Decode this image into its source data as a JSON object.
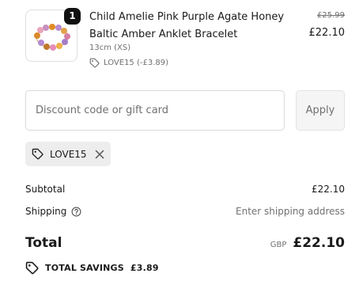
{
  "line_item": {
    "quantity": "1",
    "title": "Child Amelie Pink Purple Agate Honey Baltic Amber Anklet Bracelet",
    "variant": "13cm (XS)",
    "discount": "LOVE15 (-£3.89)",
    "original_price": "£25.99",
    "price": "£22.10"
  },
  "discount_form": {
    "placeholder": "Discount code or gift card",
    "apply_label": "Apply"
  },
  "applied_code": {
    "label": "LOVE15"
  },
  "summary": {
    "subtotal_label": "Subtotal",
    "subtotal_value": "£22.10",
    "shipping_label": "Shipping",
    "shipping_value": "Enter shipping address",
    "total_label": "Total",
    "currency": "GBP",
    "total_value": "£22.10",
    "savings_label": "TOTAL SAVINGS",
    "savings_value": "£3.89"
  },
  "icons": {
    "tag": "tag-icon",
    "close": "close-icon",
    "help": "question-circle-icon",
    "savings": "tag-icon"
  },
  "colors": {
    "text": "#1a1a1a",
    "muted": "#707070",
    "border": "#d9d9d9",
    "chip_bg": "#ededed"
  }
}
